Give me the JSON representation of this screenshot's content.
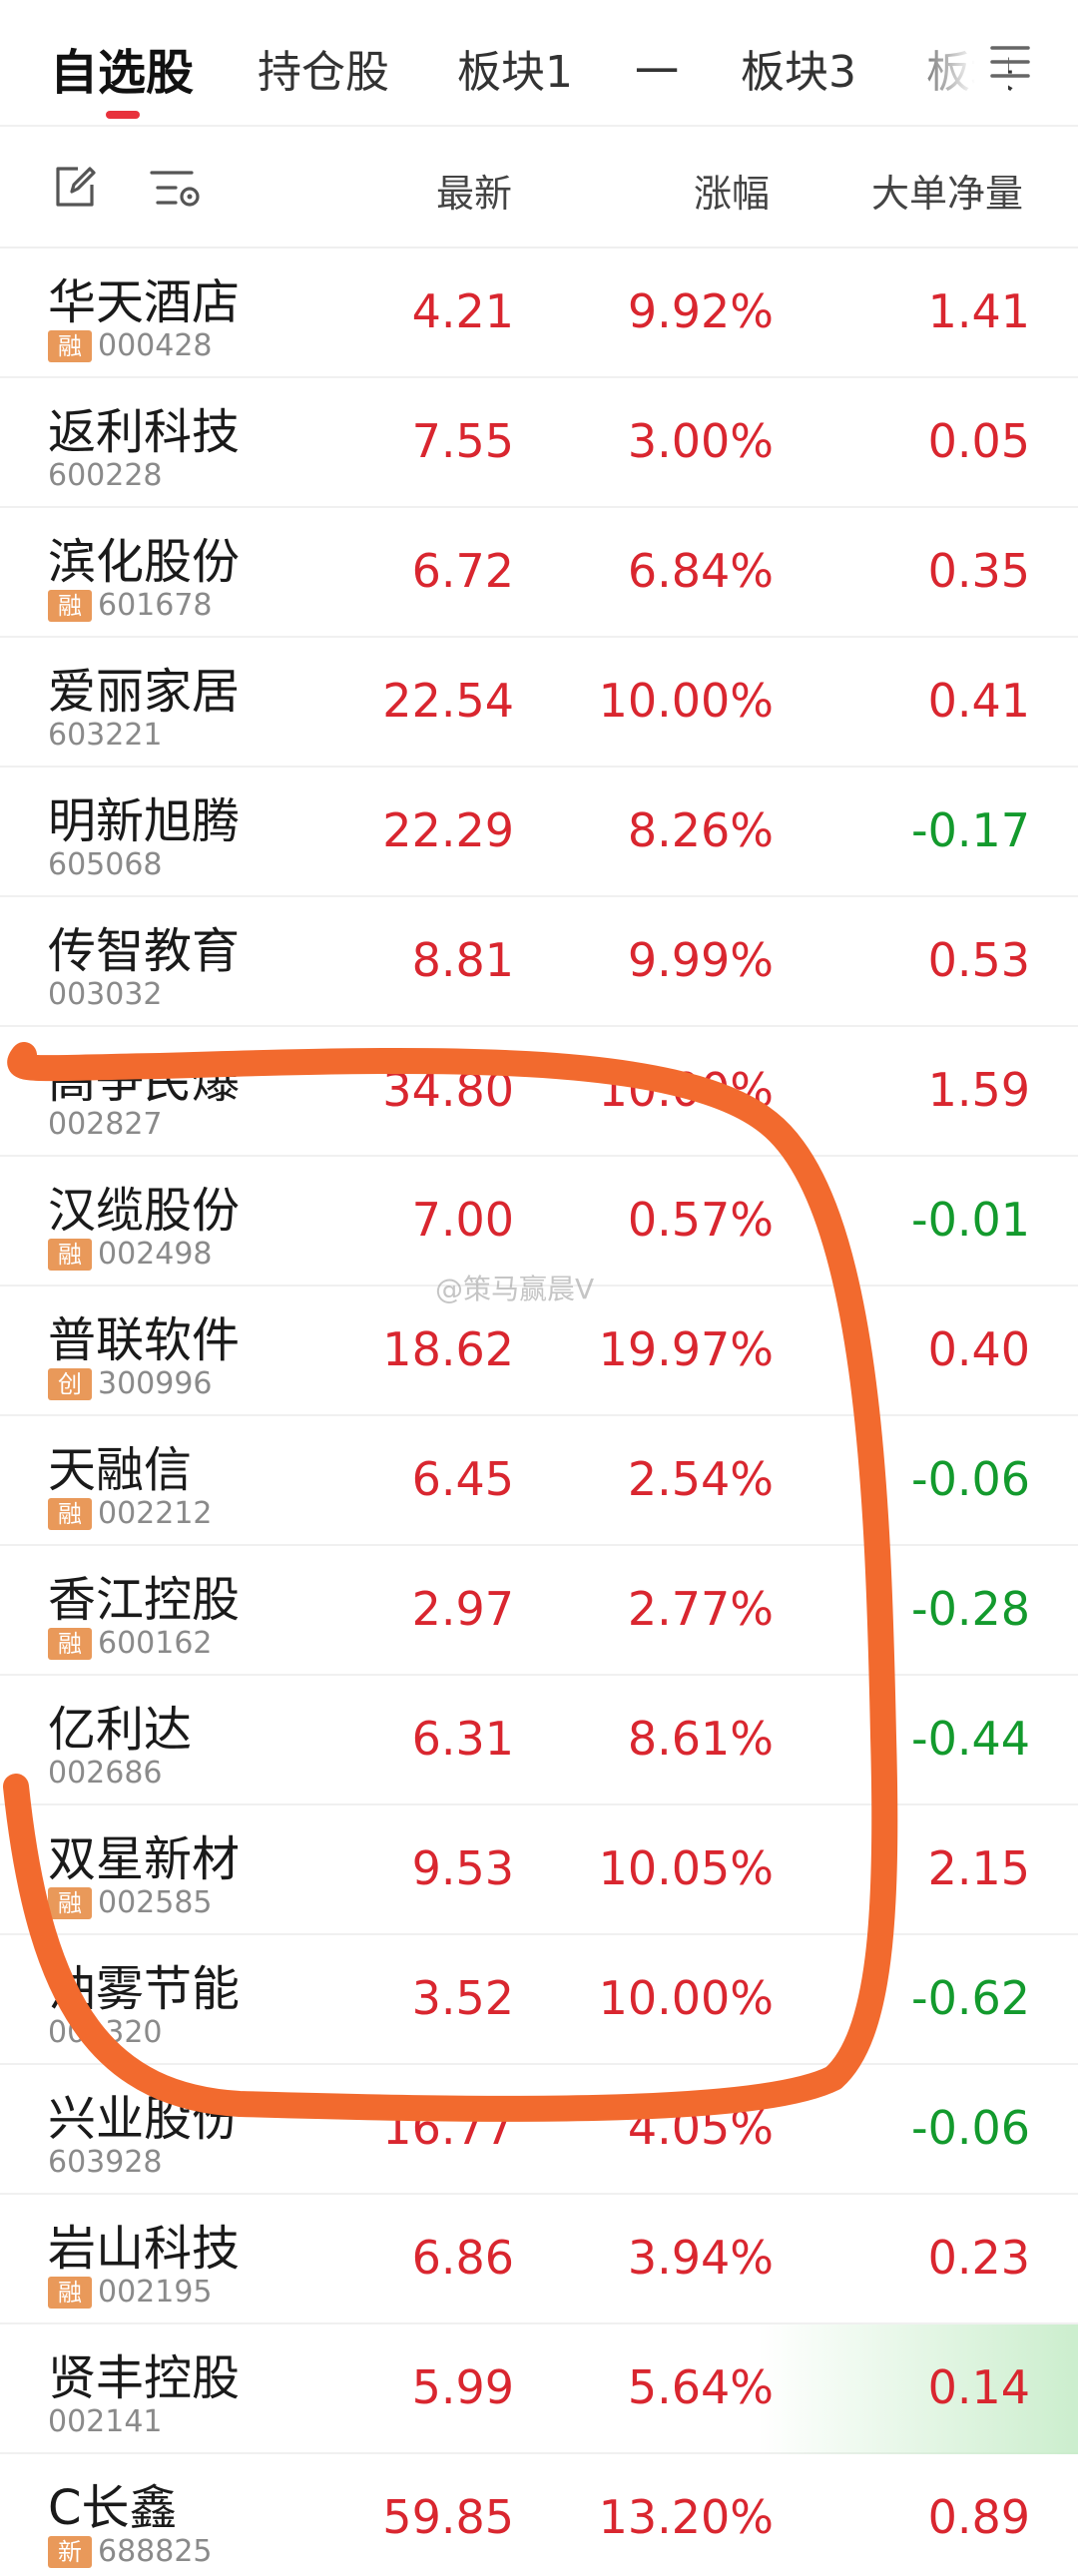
{
  "tabs": [
    "自选股",
    "持仓股",
    "板块1",
    "一",
    "板块3",
    "板块"
  ],
  "header": {
    "col_latest": "最新",
    "col_change": "涨幅",
    "col_flow": "大单净量"
  },
  "stocks": [
    {
      "name": "华天酒店",
      "tag": "融",
      "code": "000428",
      "price": "4.21",
      "change": "9.92%",
      "flow": "1.41",
      "flow_dir": "up"
    },
    {
      "name": "返利科技",
      "tag": "",
      "code": "600228",
      "price": "7.55",
      "change": "3.00%",
      "flow": "0.05",
      "flow_dir": "up"
    },
    {
      "name": "滨化股份",
      "tag": "融",
      "code": "601678",
      "price": "6.72",
      "change": "6.84%",
      "flow": "0.35",
      "flow_dir": "up"
    },
    {
      "name": "爱丽家居",
      "tag": "",
      "code": "603221",
      "price": "22.54",
      "change": "10.00%",
      "flow": "0.41",
      "flow_dir": "up"
    },
    {
      "name": "明新旭腾",
      "tag": "",
      "code": "605068",
      "price": "22.29",
      "change": "8.26%",
      "flow": "-0.17",
      "flow_dir": "down"
    },
    {
      "name": "传智教育",
      "tag": "",
      "code": "003032",
      "price": "8.81",
      "change": "9.99%",
      "flow": "0.53",
      "flow_dir": "up"
    },
    {
      "name": "高争民爆",
      "tag": "",
      "code": "002827",
      "price": "34.80",
      "change": "10.00%",
      "flow": "1.59",
      "flow_dir": "up"
    },
    {
      "name": "汉缆股份",
      "tag": "融",
      "code": "002498",
      "price": "7.00",
      "change": "0.57%",
      "flow": "-0.01",
      "flow_dir": "down"
    },
    {
      "name": "普联软件",
      "tag": "创",
      "code": "300996",
      "price": "18.62",
      "change": "19.97%",
      "flow": "0.40",
      "flow_dir": "up"
    },
    {
      "name": "天融信",
      "tag": "融",
      "code": "002212",
      "price": "6.45",
      "change": "2.54%",
      "flow": "-0.06",
      "flow_dir": "down"
    },
    {
      "name": "香江控股",
      "tag": "融",
      "code": "600162",
      "price": "2.97",
      "change": "2.77%",
      "flow": "-0.28",
      "flow_dir": "down"
    },
    {
      "name": "亿利达",
      "tag": "",
      "code": "002686",
      "price": "6.31",
      "change": "8.61%",
      "flow": "-0.44",
      "flow_dir": "down"
    },
    {
      "name": "双星新材",
      "tag": "融",
      "code": "002585",
      "price": "9.53",
      "change": "10.05%",
      "flow": "2.15",
      "flow_dir": "up"
    },
    {
      "name": "油雾节能",
      "tag": "",
      "code": "001320",
      "price": "3.52",
      "change": "10.00%",
      "flow": "-0.62",
      "flow_dir": "down"
    },
    {
      "name": "兴业股份",
      "tag": "",
      "code": "603928",
      "price": "16.77",
      "change": "4.05%",
      "flow": "-0.06",
      "flow_dir": "down"
    },
    {
      "name": "岩山科技",
      "tag": "融",
      "code": "002195",
      "price": "6.86",
      "change": "3.94%",
      "flow": "0.23",
      "flow_dir": "up"
    },
    {
      "name": "贤丰控股",
      "tag": "",
      "code": "002141",
      "price": "5.99",
      "change": "5.64%",
      "flow": "0.14",
      "flow_dir": "up",
      "highlight": true
    },
    {
      "name": "C长鑫",
      "tag": "新",
      "code": "688825",
      "price": "59.85",
      "change": "13.20%",
      "flow": "0.89",
      "flow_dir": "up"
    }
  ],
  "watermark": "@策马赢晨V",
  "colors": {
    "up": "#d9262f",
    "down": "#139a2d",
    "accent": "#e8323c",
    "annotation": "#f26a2e"
  }
}
